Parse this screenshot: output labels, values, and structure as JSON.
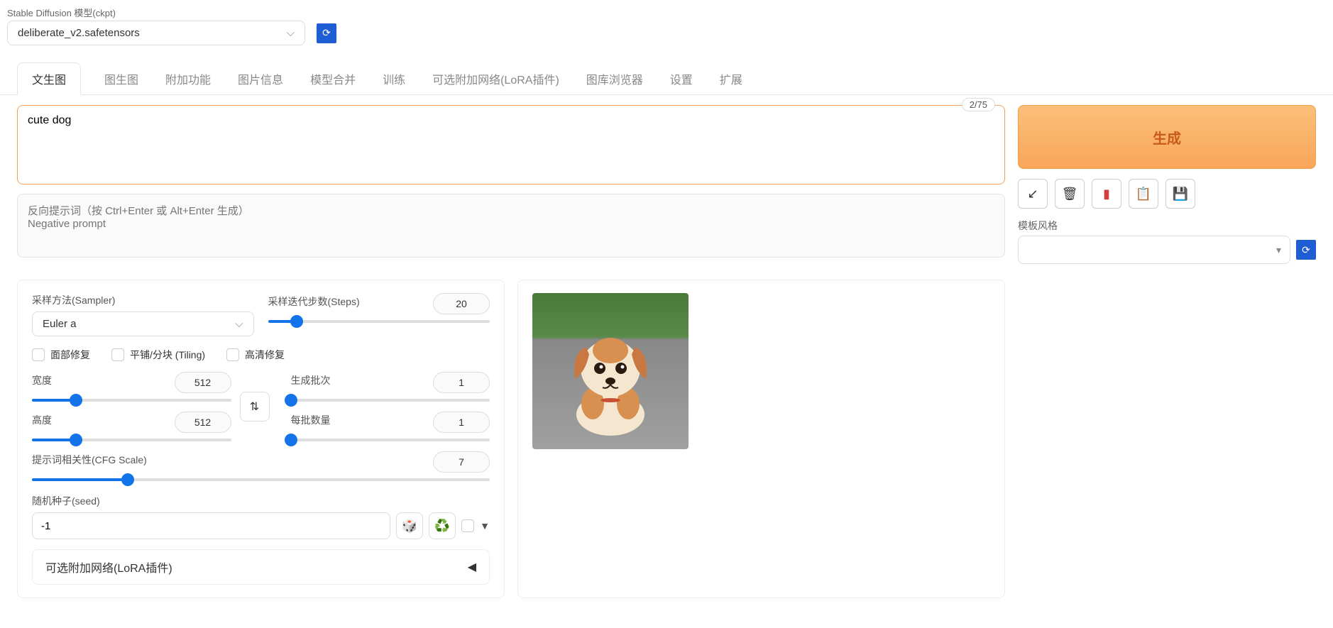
{
  "model": {
    "label": "Stable Diffusion 模型(ckpt)",
    "value": "deliberate_v2.safetensors"
  },
  "tabs": [
    "文生图",
    "图生图",
    "附加功能",
    "图片信息",
    "模型合并",
    "训练",
    "可选附加网络(LoRA插件)",
    "图库浏览器",
    "设置",
    "扩展"
  ],
  "prompt": {
    "value": "cute dog",
    "token_count": "2/75"
  },
  "neg_prompt": {
    "placeholder": "反向提示词（按 Ctrl+Enter 或 Alt+Enter 生成）\nNegative prompt"
  },
  "generate_label": "生成",
  "style": {
    "label": "模板风格"
  },
  "sampler": {
    "label": "采样方法(Sampler)",
    "value": "Euler a"
  },
  "steps": {
    "label": "采样迭代步数(Steps)",
    "value": "20",
    "pct": 13
  },
  "checks": {
    "face": "面部修复",
    "tiling": "平铺/分块 (Tiling)",
    "hires": "高清修复"
  },
  "width": {
    "label": "宽度",
    "value": "512",
    "pct": 22
  },
  "height": {
    "label": "高度",
    "value": "512",
    "pct": 22
  },
  "batch_count": {
    "label": "生成批次",
    "value": "1",
    "pct": 0
  },
  "batch_size": {
    "label": "每批数量",
    "value": "1",
    "pct": 0
  },
  "cfg": {
    "label": "提示词相关性(CFG Scale)",
    "value": "7",
    "pct": 21
  },
  "seed": {
    "label": "随机种子(seed)",
    "value": "-1"
  },
  "lora_section": "可选附加网络(LoRA插件)"
}
